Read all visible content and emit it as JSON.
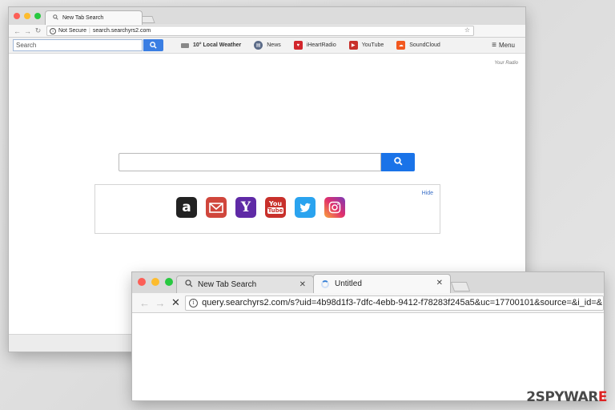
{
  "window1": {
    "tab_title": "New Tab Search",
    "not_secure": "Not Secure",
    "url": "search.searchyrs2.com",
    "toolbar": {
      "search_placeholder": "Search",
      "weather": "10° Local Weather",
      "news": "News",
      "iheartradio": "iHeartRadio",
      "youtube": "YouTube",
      "soundcloud": "SoundCloud",
      "menu": "Menu"
    },
    "your_radio": "Your Radio",
    "hide": "Hide",
    "icons": [
      {
        "name": "amazon",
        "glyph": "a",
        "color": "#222222"
      },
      {
        "name": "mail",
        "glyph": "✉",
        "color": "#d0463c"
      },
      {
        "name": "yahoo",
        "glyph": "Y",
        "color": "#5f2aa6"
      },
      {
        "name": "youtube",
        "glyph": "You",
        "color": "#c8302b"
      },
      {
        "name": "twitter",
        "glyph": "🐦",
        "color": "#2aa3ef"
      },
      {
        "name": "instagram",
        "glyph": "◎",
        "color": "#c13584"
      }
    ]
  },
  "window2": {
    "tab1_title": "New Tab Search",
    "tab2_title": "Untitled",
    "url": "query.searchyrs2.com/s?uid=4b98d1f3-7dfc-4ebb-9412-f78283f245a5&uc=17700101&source=&i_id=&"
  },
  "watermark": {
    "prefix": "2",
    "brand": "SPYWAR",
    "suffix": "E"
  },
  "colors": {
    "traffic_red": "#fc5f57",
    "traffic_yellow": "#fdbc2e",
    "traffic_green": "#28c840",
    "search_blue": "#1a73e8"
  }
}
